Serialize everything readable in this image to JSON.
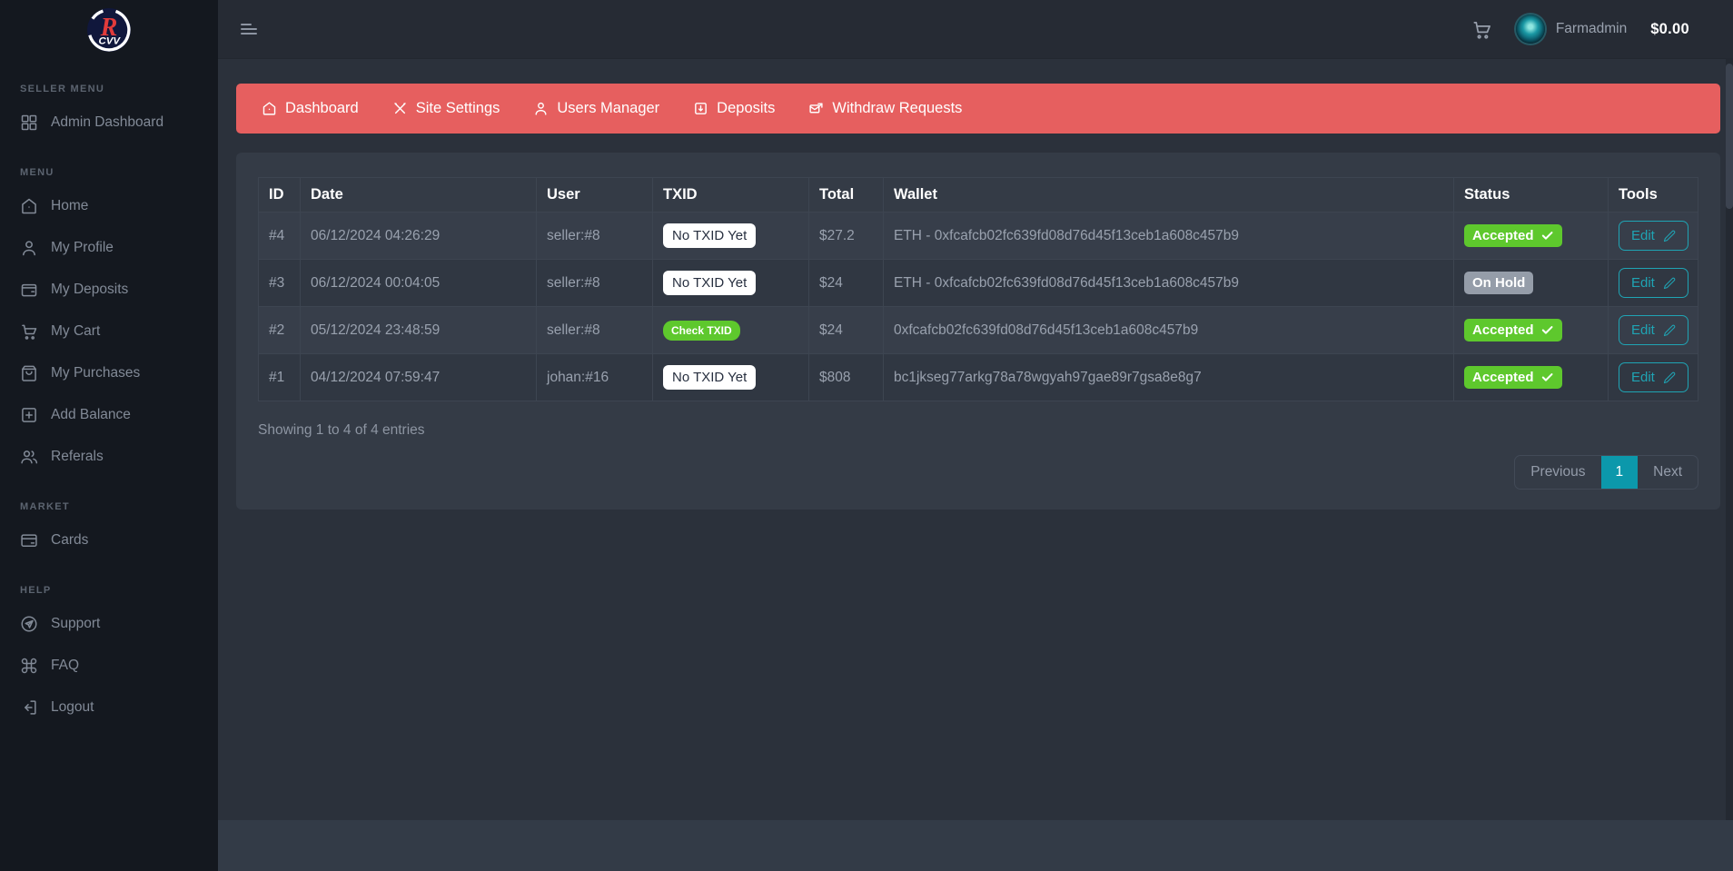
{
  "colors": {
    "accent_red": "#e65f5f",
    "accent_green": "#5ec82d",
    "accent_teal": "#1fa4b4",
    "accent_teal_dark": "#0c98ab",
    "badge_gray": "#959da9"
  },
  "topbar": {
    "username": "Farmadmin",
    "balance": "$0.00"
  },
  "sidebar": {
    "sections": [
      {
        "title": "SELLER MENU",
        "items": [
          {
            "label": "Admin Dashboard",
            "icon": "grid-icon"
          }
        ]
      },
      {
        "title": "MENU",
        "items": [
          {
            "label": "Home",
            "icon": "home-icon"
          },
          {
            "label": "My Profile",
            "icon": "user-icon"
          },
          {
            "label": "My Deposits",
            "icon": "wallet-icon"
          },
          {
            "label": "My Cart",
            "icon": "cart-icon"
          },
          {
            "label": "My Purchases",
            "icon": "bag-icon"
          },
          {
            "label": "Add Balance",
            "icon": "plus-square-icon"
          },
          {
            "label": "Referals",
            "icon": "users-icon"
          }
        ]
      },
      {
        "title": "MARKET",
        "items": [
          {
            "label": "Cards",
            "icon": "credit-card-icon"
          }
        ]
      },
      {
        "title": "HELP",
        "items": [
          {
            "label": "Support",
            "icon": "send-circle-icon"
          },
          {
            "label": "FAQ",
            "icon": "command-icon"
          },
          {
            "label": "Logout",
            "icon": "logout-icon"
          }
        ]
      }
    ]
  },
  "navbar": {
    "items": [
      {
        "label": "Dashboard",
        "icon": "home-icon"
      },
      {
        "label": "Site Settings",
        "icon": "tools-icon"
      },
      {
        "label": "Users Manager",
        "icon": "user-icon"
      },
      {
        "label": "Deposits",
        "icon": "deposit-box-icon"
      },
      {
        "label": "Withdraw Requests",
        "icon": "mail-send-icon"
      }
    ]
  },
  "table": {
    "columns": [
      "ID",
      "Date",
      "User",
      "TXID",
      "Total",
      "Wallet",
      "Status",
      "Tools"
    ],
    "rows": [
      {
        "id": "#4",
        "date": "06/12/2024 04:26:29",
        "user": "seller:#8",
        "txid": "No TXID Yet",
        "txid_style": "plain",
        "total": "$27.2",
        "wallet": "ETH - 0xfcafcb02fc639fd08d76d45f13ceb1a608c457b9",
        "status": "Accepted",
        "status_style": "accepted",
        "tool": "Edit"
      },
      {
        "id": "#3",
        "date": "06/12/2024 00:04:05",
        "user": "seller:#8",
        "txid": "No TXID Yet",
        "txid_style": "plain",
        "total": "$24",
        "wallet": "ETH - 0xfcafcb02fc639fd08d76d45f13ceb1a608c457b9",
        "status": "On Hold",
        "status_style": "hold",
        "tool": "Edit"
      },
      {
        "id": "#2",
        "date": "05/12/2024 23:48:59",
        "user": "seller:#8",
        "txid": "Check TXID",
        "txid_style": "check",
        "total": "$24",
        "wallet": "0xfcafcb02fc639fd08d76d45f13ceb1a608c457b9",
        "status": "Accepted",
        "status_style": "accepted",
        "tool": "Edit"
      },
      {
        "id": "#1",
        "date": "04/12/2024 07:59:47",
        "user": "johan:#16",
        "txid": "No TXID Yet",
        "txid_style": "plain",
        "total": "$808",
        "wallet": "bc1jkseg77arkg78a78wgyah97gae89r7gsa8e8g7",
        "status": "Accepted",
        "status_style": "accepted",
        "tool": "Edit"
      }
    ],
    "summary": "Showing 1 to 4 of 4 entries"
  },
  "pagination": {
    "previous": "Previous",
    "current": "1",
    "next": "Next"
  }
}
